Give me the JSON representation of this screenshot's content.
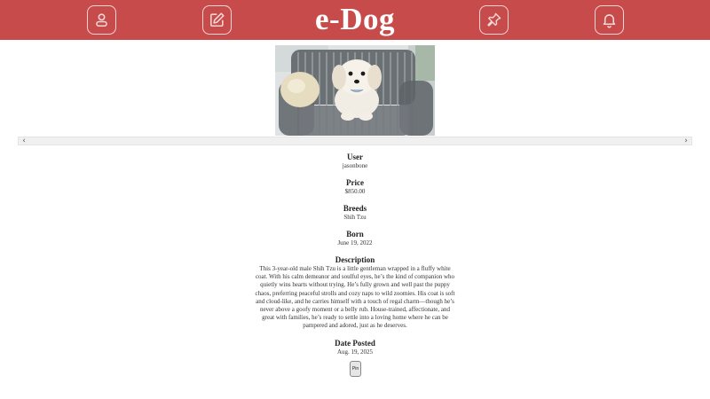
{
  "brand": "e-Dog",
  "nav": {
    "items": [
      {
        "name": "profile-button",
        "icon": "user-icon"
      },
      {
        "name": "create-post-button",
        "icon": "edit-icon"
      },
      {
        "name": "pinned-button",
        "icon": "pin-icon"
      },
      {
        "name": "notifications-button",
        "icon": "bell-icon"
      }
    ]
  },
  "listing": {
    "image_alt": "White Shih Tzu puppy on a striped armchair",
    "fields": [
      {
        "label": "User",
        "value": "jasonbone"
      },
      {
        "label": "Price",
        "value": "$850.00"
      },
      {
        "label": "Breeds",
        "value": "Shih Tzu"
      },
      {
        "label": "Born",
        "value": "June 19, 2022"
      },
      {
        "label": "Description",
        "value": "This 3-year-old male Shih Tzu is a little gentleman wrapped in a fluffy white coat. With his calm demeanor and soulful eyes, he’s the kind of companion who quietly wins hearts without trying. He’s fully grown and well past the puppy chaos, preferring peaceful strolls and cozy naps to wild zoomies. His coat is soft and cloud-like, and he carries himself with a touch of regal charm—though he’s never above a goofy moment or a belly rub. House-trained, affectionate, and great with families, he’s ready to settle into a loving home where he can be pampered and adored, just as he deserves."
      },
      {
        "label": "Date Posted",
        "value": "Aug. 19, 2025"
      }
    ],
    "pin_label": "Pin"
  },
  "colors": {
    "header": "#c84b4b",
    "header_icon": "#f3d6d6"
  }
}
